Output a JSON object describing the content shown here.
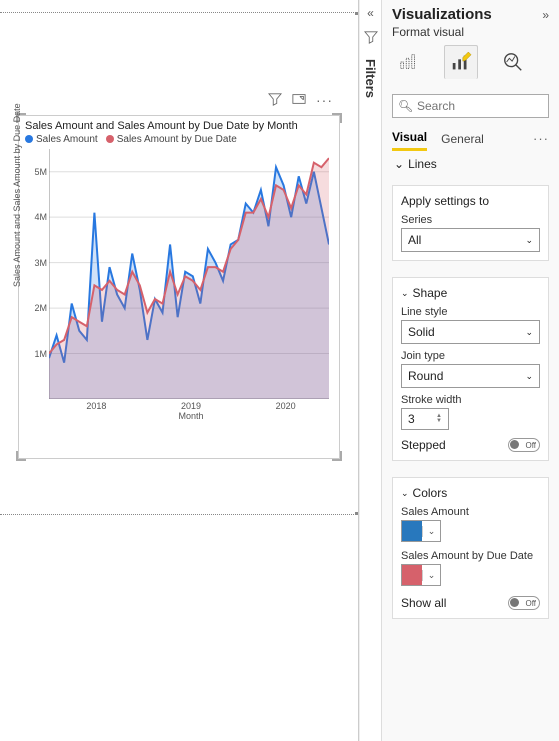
{
  "panel": {
    "title": "Visualizations",
    "subtitle": "Format visual",
    "search_placeholder": "Search",
    "subtab_visual": "Visual",
    "subtab_general": "General"
  },
  "sections": {
    "lines": "Lines",
    "apply_to_label": "Apply settings to",
    "series_label": "Series",
    "series_value": "All",
    "shape": "Shape",
    "line_style_label": "Line style",
    "line_style_value": "Solid",
    "join_type_label": "Join type",
    "join_type_value": "Round",
    "stroke_width_label": "Stroke width",
    "stroke_width_value": "3",
    "stepped_label": "Stepped",
    "stepped_value": "Off",
    "colors": "Colors",
    "color1_label": "Sales Amount",
    "color1_hex": "#2878BD",
    "color2_label": "Sales Amount by Due Date",
    "color2_hex": "#D6616B",
    "show_all_label": "Show all",
    "show_all_value": "Off"
  },
  "filters_label": "Filters",
  "chart": {
    "title": "Sales Amount and Sales Amount by Due Date by Month",
    "legend1": "Sales Amount",
    "legend2": "Sales Amount by Due Date",
    "legend1_color": "#2878E0",
    "legend2_color": "#D6616B",
    "yaxis_title": "Sales Amount and Sales Amount by Due Date",
    "xaxis_title": "Month"
  },
  "chart_data": {
    "type": "line",
    "xlabel": "Month",
    "ylabel": "Sales Amount and Sales Amount by Due Date",
    "ylim": [
      0,
      5500000
    ],
    "yticks": [
      1000000,
      2000000,
      3000000,
      4000000,
      5000000
    ],
    "ytick_labels": [
      "1M",
      "2M",
      "3M",
      "4M",
      "5M"
    ],
    "xticks": [
      "2018",
      "2019",
      "2020"
    ],
    "x": [
      0,
      1,
      2,
      3,
      4,
      5,
      6,
      7,
      8,
      9,
      10,
      11,
      12,
      13,
      14,
      15,
      16,
      17,
      18,
      19,
      20,
      21,
      22,
      23,
      24,
      25,
      26,
      27,
      28,
      29,
      30,
      31,
      32,
      33,
      34,
      35,
      36,
      37
    ],
    "series": [
      {
        "name": "Sales Amount",
        "color": "#2878E0",
        "values": [
          900000,
          1400000,
          800000,
          2100000,
          1500000,
          1300000,
          4100000,
          1700000,
          2900000,
          2300000,
          2000000,
          3200000,
          2400000,
          1300000,
          2200000,
          1900000,
          3400000,
          1800000,
          2800000,
          2700000,
          2100000,
          3300000,
          3000000,
          2600000,
          3400000,
          3500000,
          4300000,
          4100000,
          4600000,
          3800000,
          5100000,
          4700000,
          4000000,
          4900000,
          4300000,
          5000000,
          4200000,
          3400000
        ]
      },
      {
        "name": "Sales Amount by Due Date",
        "color": "#D6616B",
        "values": [
          1000000,
          1200000,
          1300000,
          1800000,
          1700000,
          1600000,
          2500000,
          2400000,
          2600000,
          2400000,
          2300000,
          2800000,
          2500000,
          1900000,
          2200000,
          2100000,
          2800000,
          2300000,
          2700000,
          2600000,
          2400000,
          2900000,
          2900000,
          2800000,
          3300000,
          3500000,
          4100000,
          4100000,
          4400000,
          4000000,
          4700000,
          4600000,
          4200000,
          4700000,
          4500000,
          5200000,
          5100000,
          5300000
        ]
      }
    ]
  }
}
